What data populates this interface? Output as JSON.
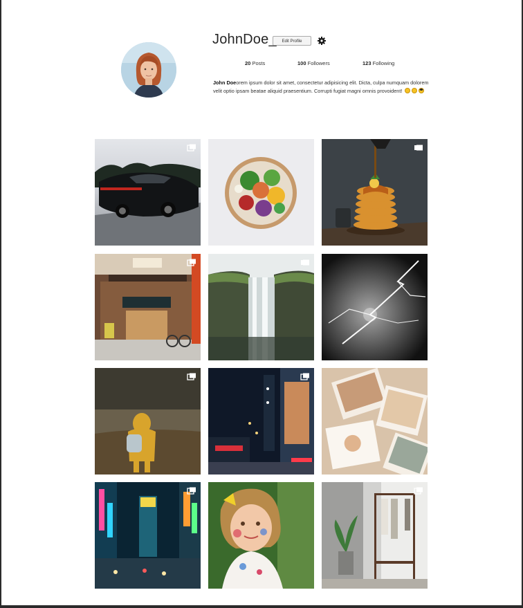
{
  "profile": {
    "username": "JohnDoe_",
    "edit_button": "Edit Profile",
    "settings_icon": "gear-icon",
    "stats": {
      "posts_count": "20",
      "posts_label": "Posts",
      "followers_count": "100",
      "followers_label": "Followers",
      "following_count": "123",
      "following_label": "Following"
    },
    "bio": {
      "name": "John Doe",
      "text": "orem ipsum dolor sit amet, consectetur adipisicing elit. Dicta, culpa numquam dolorem velit optio ipsam beatae aliquid praesentium. Corrupti fugiat magni omnis provoident!",
      "emojis": [
        "grinning-emoji",
        "smiling-emoji",
        "sunglasses-emoji"
      ]
    }
  },
  "posts": [
    {
      "subject": "black sports car on road",
      "badge": "multiple-photos-icon"
    },
    {
      "subject": "salad bowl",
      "badge": ""
    },
    {
      "subject": "pancake stack with syrup",
      "badge": "video-icon"
    },
    {
      "subject": "japanese storefront",
      "badge": "multiple-photos-icon"
    },
    {
      "subject": "waterfall",
      "badge": "video-icon"
    },
    {
      "subject": "lightning storm",
      "badge": ""
    },
    {
      "subject": "child in yellow coat",
      "badge": "multiple-photos-icon"
    },
    {
      "subject": "city street at night",
      "badge": "multiple-photos-icon"
    },
    {
      "subject": "scattered photographs",
      "badge": ""
    },
    {
      "subject": "neon city intersection",
      "badge": "multiple-photos-icon"
    },
    {
      "subject": "girl with painted face",
      "badge": ""
    },
    {
      "subject": "clothing rack and plant",
      "badge": "multiple-photos-icon"
    }
  ],
  "colors": {
    "text": "#262626",
    "border": "#2b2b2b"
  }
}
